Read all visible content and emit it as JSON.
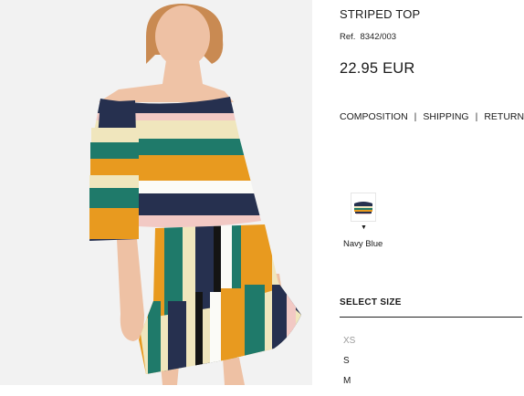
{
  "product": {
    "name": "STRIPED TOP",
    "ref_label": "Ref.",
    "ref_code": "8342/003",
    "price": "22.95 EUR"
  },
  "info_links": [
    {
      "label": "COMPOSITION"
    },
    {
      "label": "SHIPPING"
    },
    {
      "label": "RETURN"
    }
  ],
  "link_separator": "|",
  "color": {
    "selected_marker": "▼",
    "name": "Navy Blue"
  },
  "size": {
    "heading": "SELECT SIZE",
    "options": [
      {
        "label": "XS",
        "available": false
      },
      {
        "label": "S",
        "available": true
      },
      {
        "label": "M",
        "available": true
      }
    ]
  },
  "stripe_colors": {
    "navy": "#26304f",
    "mustard": "#e89a1f",
    "teal": "#1f7a6a",
    "cream": "#f0e6bd",
    "pink": "#f2c9c4",
    "white": "#fbfbf7",
    "black": "#141414"
  }
}
